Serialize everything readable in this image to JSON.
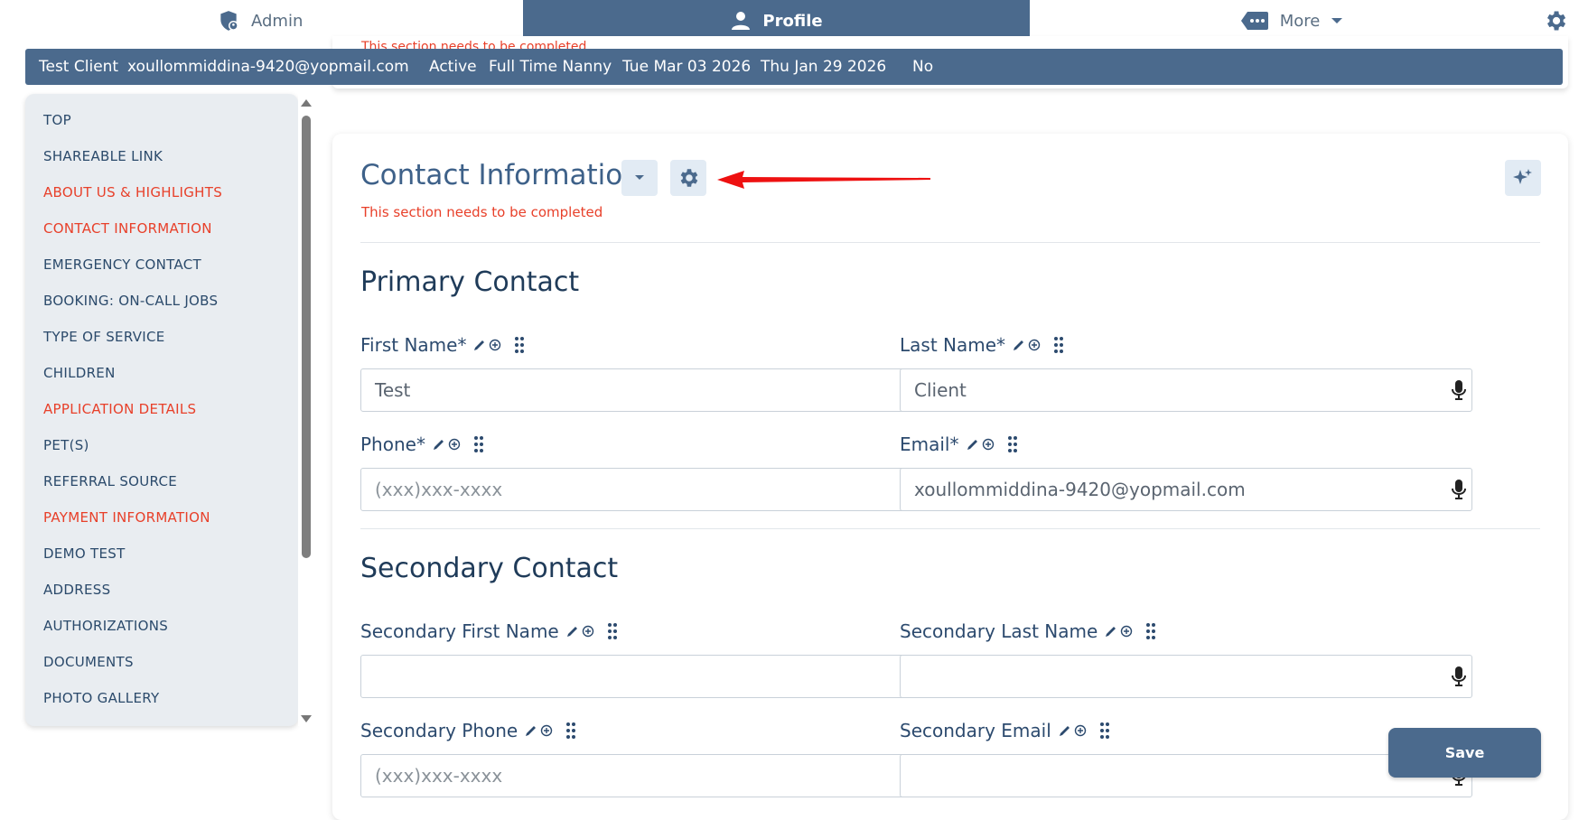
{
  "nav": {
    "admin_label": "Admin",
    "profile_label": "Profile",
    "more_label": "More"
  },
  "infobar": {
    "name": "Test Client",
    "email": "xoullommiddina-9420@yopmail.com",
    "status": "Active",
    "service": "Full Time Nanny",
    "date1": "Tue Mar 03 2026",
    "date2": "Thu Jan 29 2026",
    "flag": "No"
  },
  "behind_card_text": "This section needs to be completed",
  "sidebar": {
    "items": [
      {
        "label": "TOP",
        "incomplete": false
      },
      {
        "label": "SHAREABLE LINK",
        "incomplete": false
      },
      {
        "label": "ABOUT US & HIGHLIGHTS",
        "incomplete": true
      },
      {
        "label": "CONTACT INFORMATION",
        "incomplete": true
      },
      {
        "label": "EMERGENCY CONTACT",
        "incomplete": false
      },
      {
        "label": "BOOKING: ON-CALL JOBS",
        "incomplete": false
      },
      {
        "label": "TYPE OF SERVICE",
        "incomplete": false
      },
      {
        "label": "CHILDREN",
        "incomplete": false
      },
      {
        "label": "APPLICATION DETAILS",
        "incomplete": true
      },
      {
        "label": "PET(S)",
        "incomplete": false
      },
      {
        "label": "REFERRAL SOURCE",
        "incomplete": false
      },
      {
        "label": "PAYMENT INFORMATION",
        "incomplete": true
      },
      {
        "label": "DEMO TEST",
        "incomplete": false
      },
      {
        "label": "ADDRESS",
        "incomplete": false
      },
      {
        "label": "AUTHORIZATIONS",
        "incomplete": false
      },
      {
        "label": "DOCUMENTS",
        "incomplete": false
      },
      {
        "label": "PHOTO GALLERY",
        "incomplete": false
      }
    ]
  },
  "section": {
    "title": "Contact Information",
    "warning": "This section needs to be completed",
    "primary_title": "Primary Contact",
    "secondary_title": "Secondary Contact"
  },
  "fields": {
    "first_name": {
      "label": "First Name*",
      "value": "Test",
      "placeholder": ""
    },
    "last_name": {
      "label": "Last Name*",
      "value": "Client",
      "placeholder": ""
    },
    "phone": {
      "label": "Phone*",
      "value": "",
      "placeholder": "(xxx)xxx-xxxx"
    },
    "email": {
      "label": "Email*",
      "value": "xoullommiddina-9420@yopmail.com",
      "placeholder": ""
    },
    "sec_first_name": {
      "label": "Secondary First Name",
      "value": "",
      "placeholder": ""
    },
    "sec_last_name": {
      "label": "Secondary Last Name",
      "value": "",
      "placeholder": ""
    },
    "sec_phone": {
      "label": "Secondary Phone",
      "value": "",
      "placeholder": "(xxx)xxx-xxxx"
    },
    "sec_email": {
      "label": "Secondary Email",
      "value": "",
      "placeholder": ""
    }
  },
  "save_label": "Save",
  "colors": {
    "primary": "#4b6a8d",
    "incomplete": "#e8402a",
    "annotation_arrow": "#ee1111"
  },
  "icons": [
    "shield-user-icon",
    "user-icon",
    "more-dots-icon",
    "gear-icon",
    "chevron-down-icon",
    "sparkle-icon",
    "edit-pencil-icon",
    "add-circle-icon",
    "drag-handle-icon",
    "microphone-icon"
  ]
}
